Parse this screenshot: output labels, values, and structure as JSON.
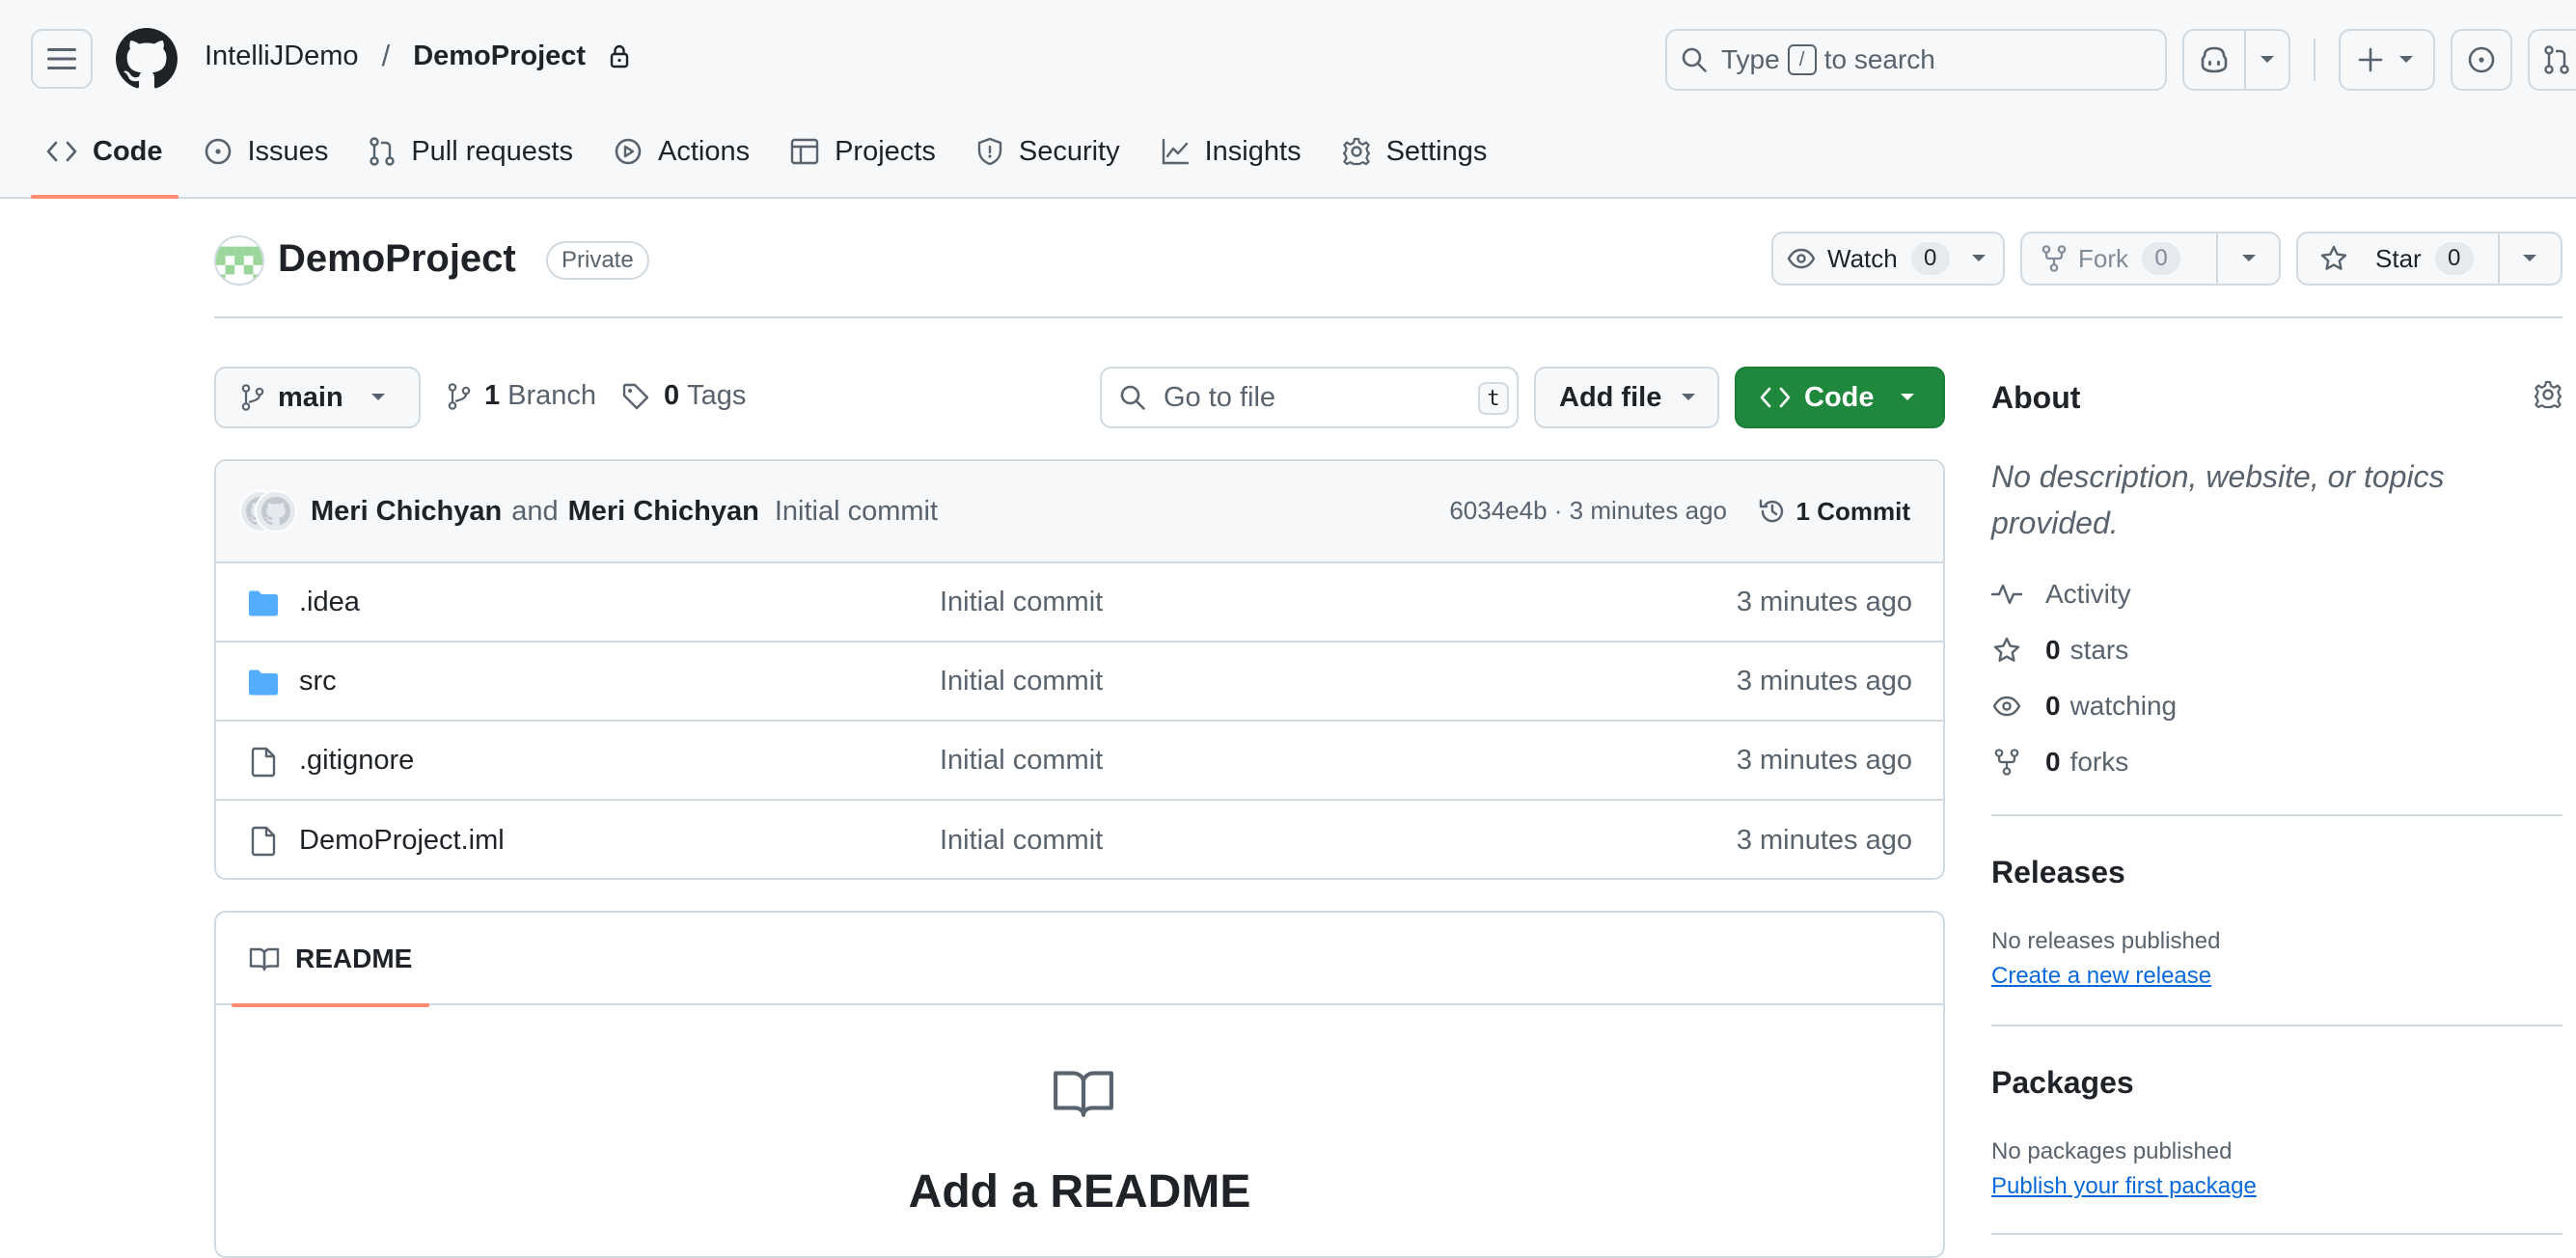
{
  "header": {
    "owner": "IntelliJDemo",
    "separator": "/",
    "repo": "DemoProject",
    "search": {
      "prefix": "Type",
      "key": "/",
      "suffix": "to search"
    }
  },
  "tabs": [
    {
      "label": "Code",
      "icon": "code-icon",
      "active": true
    },
    {
      "label": "Issues",
      "icon": "issue-icon"
    },
    {
      "label": "Pull requests",
      "icon": "pull-request-icon"
    },
    {
      "label": "Actions",
      "icon": "play-icon"
    },
    {
      "label": "Projects",
      "icon": "table-icon"
    },
    {
      "label": "Security",
      "icon": "shield-icon"
    },
    {
      "label": "Insights",
      "icon": "graph-icon"
    },
    {
      "label": "Settings",
      "icon": "gear-icon"
    }
  ],
  "repo": {
    "name": "DemoProject",
    "visibility": "Private",
    "watch": {
      "label": "Watch",
      "count": "0"
    },
    "fork": {
      "label": "Fork",
      "count": "0"
    },
    "star": {
      "label": "Star",
      "count": "0"
    }
  },
  "toolbar": {
    "branch": "main",
    "branches_count": "1",
    "branches_label": "Branch",
    "tags_count": "0",
    "tags_label": "Tags",
    "goto_placeholder": "Go to file",
    "goto_key": "t",
    "add_file": "Add file",
    "code": "Code"
  },
  "commit": {
    "author1": "Meri Chichyan",
    "and": "and",
    "author2": "Meri Chichyan",
    "message": "Initial commit",
    "meta": "6034e4b · 3 minutes ago",
    "count_label": "1 Commit"
  },
  "files": [
    {
      "name": ".idea",
      "type": "folder",
      "message": "Initial commit",
      "time": "3 minutes ago"
    },
    {
      "name": "src",
      "type": "folder",
      "message": "Initial commit",
      "time": "3 minutes ago"
    },
    {
      "name": ".gitignore",
      "type": "file",
      "message": "Initial commit",
      "time": "3 minutes ago"
    },
    {
      "name": "DemoProject.iml",
      "type": "file",
      "message": "Initial commit",
      "time": "3 minutes ago"
    }
  ],
  "readme": {
    "tab": "README",
    "empty_title": "Add a README"
  },
  "sidebar": {
    "about_title": "About",
    "about_desc": "No description, website, or topics provided.",
    "activity": "Activity",
    "stars_count": "0",
    "stars_label": "stars",
    "watching_count": "0",
    "watching_label": "watching",
    "forks_count": "0",
    "forks_label": "forks",
    "releases_title": "Releases",
    "releases_none": "No releases published",
    "releases_link": "Create a new release",
    "packages_title": "Packages",
    "packages_none": "No packages published",
    "packages_link": "Publish your first package"
  },
  "colors": {
    "accent_underline": "#fd8c73",
    "primary_button": "#1f883d",
    "link": "#0969da",
    "folder": "#54aeff",
    "border": "#d1d9e0",
    "muted_text": "#59636e"
  }
}
